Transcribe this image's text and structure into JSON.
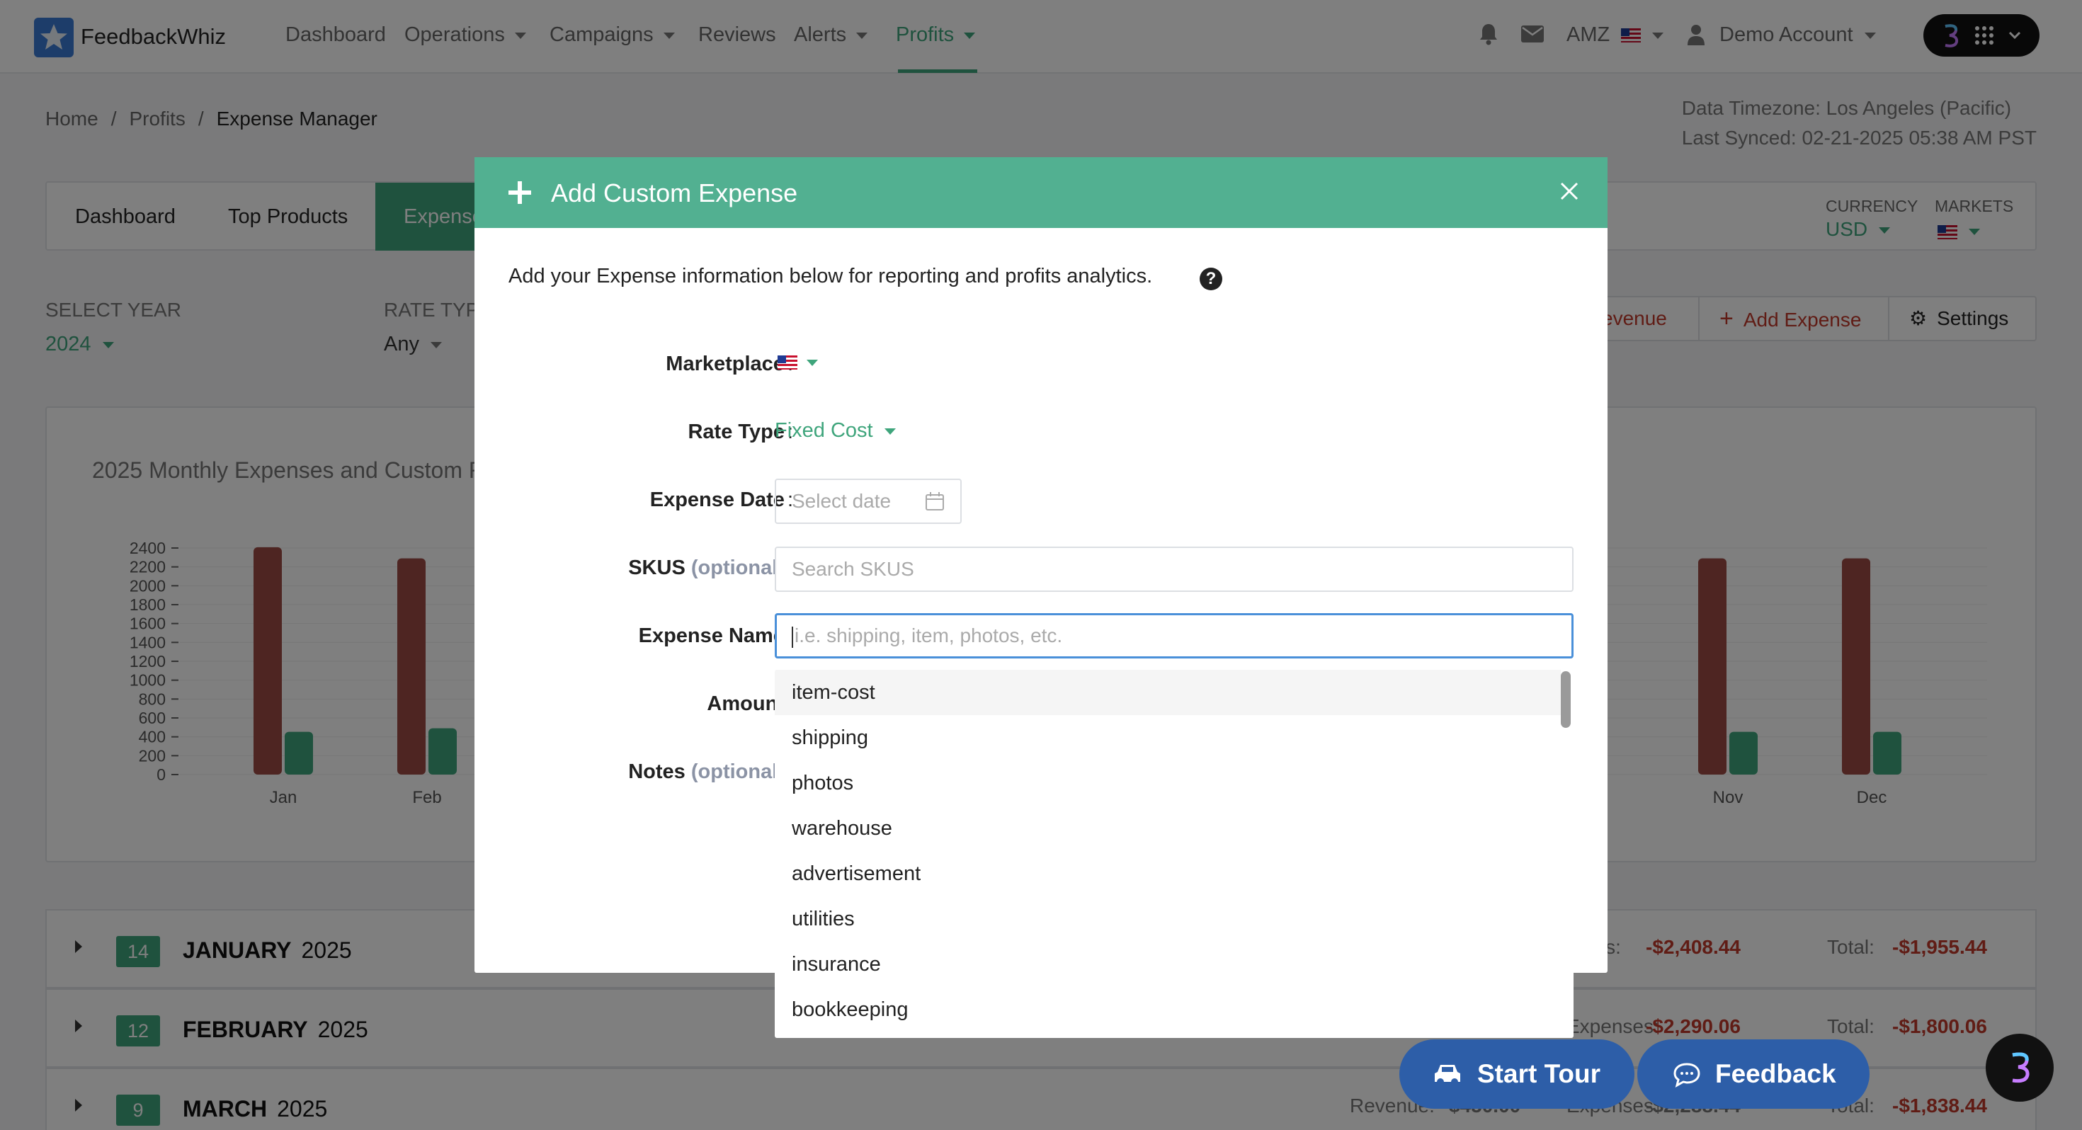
{
  "app": {
    "name": "FeedbackWhiz"
  },
  "nav": {
    "items": [
      {
        "label": "Dashboard",
        "caret": false
      },
      {
        "label": "Operations",
        "caret": true
      },
      {
        "label": "Campaigns",
        "caret": true
      },
      {
        "label": "Reviews",
        "caret": false
      },
      {
        "label": "Alerts",
        "caret": true
      },
      {
        "label": "Profits",
        "caret": true,
        "active": true
      }
    ],
    "marketplace": "AMZ",
    "account": "Demo Account"
  },
  "breadcrumb": {
    "home": "Home",
    "section": "Profits",
    "current": "Expense Manager"
  },
  "sync": {
    "timezone": "Data Timezone: Los Angeles (Pacific)",
    "last_synced": "Last Synced: 02-21-2025 05:38 AM PST"
  },
  "tabs": {
    "dashboard": "Dashboard",
    "top_products": "Top Products",
    "expenses": "Expense"
  },
  "settings_bar": {
    "currency_label": "CURRENCY",
    "currency_value": "USD",
    "markets_label": "MARKETS"
  },
  "filters": {
    "year_label": "SELECT YEAR",
    "year_value": "2024",
    "rate_label": "RATE TYP",
    "rate_value": "Any"
  },
  "actions": {
    "revenue": "evenue",
    "add_expense": "Add Expense",
    "settings": "Settings"
  },
  "chart_data": {
    "type": "bar",
    "title": "2025 Monthly Expenses and Custom R",
    "categories": [
      "Jan",
      "Feb",
      "Nov",
      "Dec"
    ],
    "series": [
      {
        "values": [
          2408.44,
          2290.06,
          2290,
          2290
        ]
      },
      {
        "values": [
          453,
          490,
          453,
          453
        ]
      }
    ],
    "y_ticks": [
      "2400",
      "2200",
      "2000",
      "1800",
      "1600",
      "1400",
      "1200",
      "1000",
      "800",
      "600",
      "400",
      "200",
      "0"
    ],
    "ylim": [
      0,
      2400
    ],
    "colors": [
      "#9c4b44",
      "#3fa57c"
    ],
    "grid": true
  },
  "months": [
    {
      "count": "14",
      "name": "JANUARY",
      "year": "2025",
      "revenue_label": "",
      "revenue": "",
      "expenses_label": "nses:",
      "expenses": "-$2,408.44",
      "total_label": "Total:",
      "total": "-$1,955.44"
    },
    {
      "count": "12",
      "name": "FEBRUARY",
      "year": "2025",
      "revenue_label": "",
      "revenue": "",
      "expenses_label": "Expenses:",
      "expenses": "-$2,290.06",
      "total_label": "Total:",
      "total": "-$1,800.06"
    },
    {
      "count": "9",
      "name": "MARCH",
      "year": "2025",
      "revenue_label": "Revenue:",
      "revenue": "$450.00",
      "expenses_label": "Expenses:",
      "expenses": "-$2,288.44",
      "total_label": "Total:",
      "total": "-$1,838.44"
    }
  ],
  "modal": {
    "title": "Add Custom Expense",
    "intro": "Add your Expense information below for reporting and profits analytics.",
    "help": "?",
    "fields": {
      "marketplace": "Marketplace",
      "rate_type": "Rate Type",
      "rate_type_value": "Fixed Cost",
      "expense_date": "Expense Date",
      "expense_date_placeholder": "Select date",
      "skus": "SKUS",
      "optional": "(optional)",
      "skus_placeholder": "Search SKUS",
      "expense_name": "Expense Name",
      "expense_name_placeholder": "i.e. shipping, item, photos, etc.",
      "amount": "Amount",
      "notes": "Notes",
      "colon": ":"
    },
    "suggestions": [
      "item-cost",
      "shipping",
      "photos",
      "warehouse",
      "advertisement",
      "utilities",
      "insurance",
      "bookkeeping"
    ]
  },
  "floating": {
    "start_tour": "Start Tour",
    "feedback": "Feedback"
  },
  "colors": {
    "accent": "#3fa57c",
    "modal_header": "#52b091",
    "float_button": "#2d5ea8",
    "negative": "#c0392b"
  }
}
